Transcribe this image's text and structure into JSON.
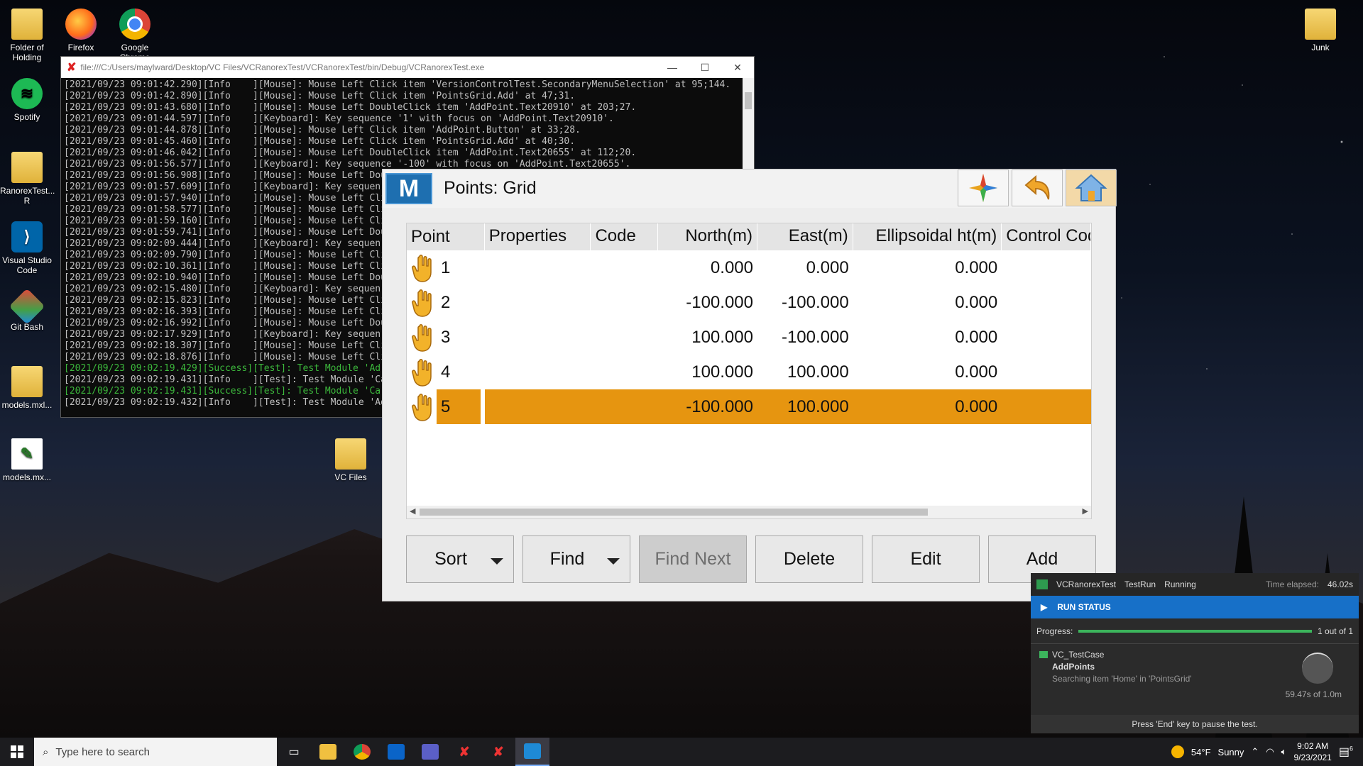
{
  "desktop": {
    "icons": [
      {
        "label": "Folder of Holding"
      },
      {
        "label": "Firefox"
      },
      {
        "label": "Google Chrome"
      },
      {
        "label": "Spotify"
      },
      {
        "label": "RanorexTest... R"
      },
      {
        "label": "Visual Studio Code"
      },
      {
        "label": "Git Bash"
      },
      {
        "label": "models.mxl..."
      },
      {
        "label": "models.mx..."
      },
      {
        "label": "VC Files"
      },
      {
        "label": "Junk"
      }
    ]
  },
  "console": {
    "path": "file:///C:/Users/maylward/Desktop/VC Files/VCRanorexTest/VCRanorexTest/bin/Debug/VCRanorexTest.exe",
    "lines": [
      {
        "text": "[2021/09/23 09:01:42.290][Info    ][Mouse]: Mouse Left Click item 'VersionControlTest.SecondaryMenuSelection' at 95;144.",
        "ok": false
      },
      {
        "text": "[2021/09/23 09:01:42.890][Info    ][Mouse]: Mouse Left Click item 'PointsGrid.Add' at 47;31.",
        "ok": false
      },
      {
        "text": "[2021/09/23 09:01:43.680][Info    ][Mouse]: Mouse Left DoubleClick item 'AddPoint.Text20910' at 203;27.",
        "ok": false
      },
      {
        "text": "[2021/09/23 09:01:44.597][Info    ][Keyboard]: Key sequence '1' with focus on 'AddPoint.Text20910'.",
        "ok": false
      },
      {
        "text": "[2021/09/23 09:01:44.878][Info    ][Mouse]: Mouse Left Click item 'AddPoint.Button' at 33;28.",
        "ok": false
      },
      {
        "text": "[2021/09/23 09:01:45.460][Info    ][Mouse]: Mouse Left Click item 'PointsGrid.Add' at 40;30.",
        "ok": false
      },
      {
        "text": "[2021/09/23 09:01:46.042][Info    ][Mouse]: Mouse Left DoubleClick item 'AddPoint.Text20655' at 112;20.",
        "ok": false
      },
      {
        "text": "[2021/09/23 09:01:56.577][Info    ][Keyboard]: Key sequence '-100' with focus on 'AddPoint.Text20655'.",
        "ok": false
      },
      {
        "text": "[2021/09/23 09:01:56.908][Info    ][Mouse]: Mouse Left Dou",
        "ok": false
      },
      {
        "text": "[2021/09/23 09:01:57.609][Info    ][Keyboard]: Key sequen",
        "ok": false
      },
      {
        "text": "[2021/09/23 09:01:57.940][Info    ][Mouse]: Mouse Left Cli",
        "ok": false
      },
      {
        "text": "[2021/09/23 09:01:58.577][Info    ][Mouse]: Mouse Left Cli",
        "ok": false
      },
      {
        "text": "[2021/09/23 09:01:59.160][Info    ][Mouse]: Mouse Left Cli",
        "ok": false
      },
      {
        "text": "[2021/09/23 09:01:59.741][Info    ][Mouse]: Mouse Left Dou",
        "ok": false
      },
      {
        "text": "[2021/09/23 09:02:09.444][Info    ][Keyboard]: Key sequen",
        "ok": false
      },
      {
        "text": "[2021/09/23 09:02:09.790][Info    ][Mouse]: Mouse Left Cli",
        "ok": false
      },
      {
        "text": "[2021/09/23 09:02:10.361][Info    ][Mouse]: Mouse Left Cli",
        "ok": false
      },
      {
        "text": "[2021/09/23 09:02:10.940][Info    ][Mouse]: Mouse Left Dou",
        "ok": false
      },
      {
        "text": "[2021/09/23 09:02:15.480][Info    ][Keyboard]: Key sequen",
        "ok": false
      },
      {
        "text": "[2021/09/23 09:02:15.823][Info    ][Mouse]: Mouse Left Cli",
        "ok": false
      },
      {
        "text": "[2021/09/23 09:02:16.393][Info    ][Mouse]: Mouse Left Cli",
        "ok": false
      },
      {
        "text": "[2021/09/23 09:02:16.992][Info    ][Mouse]: Mouse Left Dou",
        "ok": false
      },
      {
        "text": "[2021/09/23 09:02:17.929][Info    ][Keyboard]: Key sequen",
        "ok": false
      },
      {
        "text": "[2021/09/23 09:02:18.307][Info    ][Mouse]: Mouse Left Cli",
        "ok": false
      },
      {
        "text": "[2021/09/23 09:02:18.876][Info    ][Mouse]: Mouse Left Cli",
        "ok": false
      },
      {
        "text": "[2021/09/23 09:02:19.429][Success][Test]: Test Module 'Ad",
        "ok": true
      },
      {
        "text": "[2021/09/23 09:02:19.431][Info    ][Test]: Test Module 'Ca",
        "ok": false
      },
      {
        "text": "[2021/09/23 09:02:19.431][Success][Test]: Test Module 'Ca",
        "ok": true
      },
      {
        "text": "[2021/09/23 09:02:19.432][Info    ][Test]: Test Module 'Ad",
        "ok": false
      }
    ]
  },
  "app": {
    "logo": "M",
    "title": "Points: Grid",
    "header_buttons": [
      {
        "icon": "compass-star-icon"
      },
      {
        "icon": "back-arrow-icon"
      },
      {
        "icon": "home-icon"
      }
    ],
    "grid": {
      "columns": [
        "Point",
        "Properties",
        "Code",
        "North(m)",
        "East(m)",
        "Ellipsoidal ht(m)",
        "Control Cod"
      ],
      "rows": [
        {
          "point": "1",
          "properties": "",
          "code": "",
          "north": "0.000",
          "east": "0.000",
          "ell": "0.000",
          "control": "",
          "selected": false
        },
        {
          "point": "2",
          "properties": "",
          "code": "",
          "north": "-100.000",
          "east": "-100.000",
          "ell": "0.000",
          "control": "",
          "selected": false
        },
        {
          "point": "3",
          "properties": "",
          "code": "",
          "north": "100.000",
          "east": "-100.000",
          "ell": "0.000",
          "control": "",
          "selected": false
        },
        {
          "point": "4",
          "properties": "",
          "code": "",
          "north": "100.000",
          "east": "100.000",
          "ell": "0.000",
          "control": "",
          "selected": false
        },
        {
          "point": "5",
          "properties": "",
          "code": "",
          "north": "-100.000",
          "east": "100.000",
          "ell": "0.000",
          "control": "",
          "selected": true
        }
      ]
    },
    "buttons": {
      "sort": "Sort",
      "find": "Find",
      "find_next": "Find Next",
      "delete": "Delete",
      "edit": "Edit",
      "add": "Add"
    },
    "selected_color": "#e69510"
  },
  "run_panel": {
    "app": "VCRanorexTest",
    "run": "TestRun",
    "state": "Running",
    "elapsed_label": "Time elapsed:",
    "elapsed": "46.02s",
    "status_title": "RUN STATUS",
    "progress_label": "Progress:",
    "progress_text": "1 out of 1",
    "progress": 1.0,
    "case_name": "VC_TestCase",
    "module": "AddPoints",
    "action": "Searching item 'Home' in 'PointsGrid'",
    "timeout": "59.47s of 1.0m",
    "footer": "Press 'End' key to pause the test."
  },
  "taskbar": {
    "search_placeholder": "Type here to search",
    "weather_temp": "54°F",
    "weather_cond": "Sunny",
    "time": "9:02 AM",
    "date": "9/23/2021",
    "notif_count": "6"
  }
}
